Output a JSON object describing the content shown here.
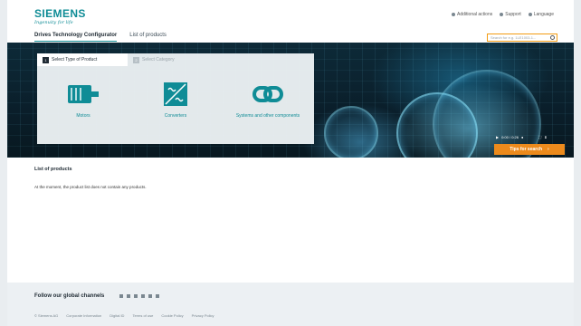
{
  "brand": {
    "name": "SIEMENS",
    "tagline": "Ingenuity for life"
  },
  "top_links": [
    {
      "label": "Additional actions",
      "icon": "settings-icon"
    },
    {
      "label": "Support",
      "icon": "support-icon"
    },
    {
      "label": "Language",
      "icon": "globe-icon"
    }
  ],
  "nav": {
    "tab_configurator": "Drives Technology Configurator",
    "tab_products": "List of products"
  },
  "search": {
    "placeholder": "Search for e.g. 1LE1003-1..."
  },
  "steps": [
    {
      "num": "1",
      "label": "Select Type of Product"
    },
    {
      "num": "2",
      "label": "Select Category"
    }
  ],
  "categories": [
    {
      "label": "Motors",
      "icon": "motor-icon"
    },
    {
      "label": "Converters",
      "icon": "converter-icon"
    },
    {
      "label": "Systems and other components",
      "icon": "link-icon"
    }
  ],
  "video": {
    "time": "0:00 / 0:26"
  },
  "cta": {
    "label": "Tips for search",
    "arrow": "›"
  },
  "products": {
    "title": "List of products",
    "message": "At the moment, the product list does not contain any products."
  },
  "footer": {
    "follow": "Follow our global channels",
    "legal": [
      "© Siemens AG",
      "Corporate Information",
      "Digital ID",
      "Terms of use",
      "Cookie Policy",
      "Privacy Policy"
    ]
  },
  "colors": {
    "accent": "#0f8c96",
    "cta": "#ec8a1c",
    "search_border": "#f39c12"
  }
}
